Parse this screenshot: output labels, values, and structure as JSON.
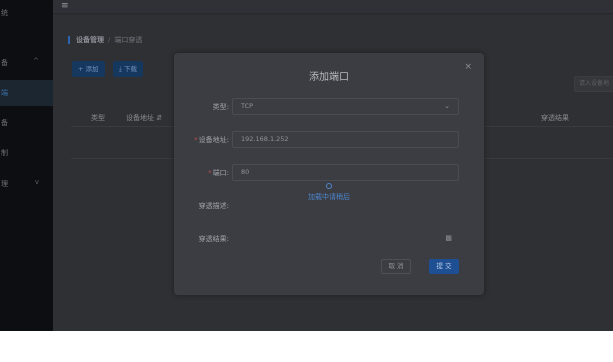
{
  "sidebar": {
    "items": [
      {
        "label": "统",
        "chevron": "",
        "active": false
      },
      {
        "label": "备",
        "chevron": "^",
        "active": false
      },
      {
        "label": "端",
        "chevron": "",
        "active": true
      },
      {
        "label": "备",
        "chevron": "",
        "active": false
      },
      {
        "label": "制",
        "chevron": "",
        "active": false
      },
      {
        "label": "理",
        "chevron": "v",
        "active": false
      }
    ]
  },
  "topbar": {
    "menu_icon": "≡"
  },
  "breadcrumb": {
    "current": "设备管理",
    "separator": "/",
    "page": "端口穿透"
  },
  "toolbar": {
    "add_label": "+ 添加",
    "download_label": "⤓ 下载"
  },
  "search": {
    "placeholder": "请入设备地"
  },
  "table": {
    "columns": [
      "类型",
      "设备地址 ⇵",
      "穿透结果"
    ]
  },
  "modal": {
    "title": "添加端口",
    "close": "×",
    "fields": {
      "type_label": "类型:",
      "type_value": "TCP",
      "address_label": "设备地址:",
      "address_value": "192.168.1.252",
      "port_label": "端口:",
      "port_value": "80",
      "desc_label": "穿透描述:",
      "result_label": "穿透结果:"
    },
    "loading_text": "加载中请稍后",
    "cancel_label": "取 消",
    "submit_label": "提 交"
  }
}
